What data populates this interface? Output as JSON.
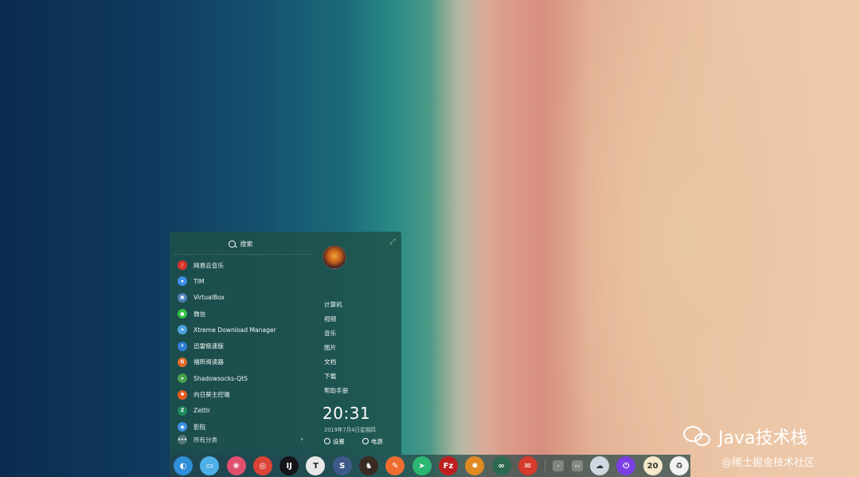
{
  "launcher": {
    "search_label": "搜索",
    "apps": [
      {
        "label": "网易云音乐",
        "icon": "netease-music-icon",
        "color": "#d8332a",
        "glyph": "♪"
      },
      {
        "label": "TIM",
        "icon": "tim-icon",
        "color": "#3a8ee6",
        "glyph": "★"
      },
      {
        "label": "VirtualBox",
        "icon": "virtualbox-icon",
        "color": "#4a7fb8",
        "glyph": "▣"
      },
      {
        "label": "微信",
        "icon": "wechat-icon",
        "color": "#35c24a",
        "glyph": "●"
      },
      {
        "label": "Xtreme Download Manager",
        "icon": "xdm-icon",
        "color": "#4aa3df",
        "glyph": "✦"
      },
      {
        "label": "迅雷极速版",
        "icon": "thunder-icon",
        "color": "#2f7dd6",
        "glyph": "✈"
      },
      {
        "label": "福昕阅读器",
        "icon": "foxit-reader-icon",
        "color": "#e06a2b",
        "glyph": "G"
      },
      {
        "label": "Shadowsocks-QtS",
        "icon": "shadowsocks-icon",
        "color": "#47a14a",
        "glyph": "➤"
      },
      {
        "label": "向日葵主控端",
        "icon": "sunlogin-icon",
        "color": "#e55a1f",
        "glyph": "✺"
      },
      {
        "label": "Zettlr",
        "icon": "zettlr-icon",
        "color": "#1f8a5a",
        "glyph": "Z"
      },
      {
        "label": "影院",
        "icon": "cinema-icon",
        "color": "#3d8fe0",
        "glyph": "◉"
      }
    ],
    "all_categories": "所有分类",
    "nav": [
      "计算机",
      "视频",
      "音乐",
      "图片",
      "文档",
      "下载",
      "帮助手册"
    ],
    "clock": "20:31",
    "date": "2019年7月4日星期四",
    "settings_label": "设置",
    "power_label": "电源"
  },
  "dock": {
    "apps": [
      {
        "icon": "deepin-launcher-icon",
        "color": "#2f8fd8",
        "glyph": "◐"
      },
      {
        "icon": "file-manager-icon",
        "color": "#4fb0e8",
        "glyph": "▭"
      },
      {
        "icon": "sakura-icon",
        "color": "#e0506e",
        "glyph": "❀"
      },
      {
        "icon": "chrome-icon",
        "color": "#db4437",
        "glyph": "◎"
      },
      {
        "icon": "intellij-idea-icon",
        "color": "#16151a",
        "glyph": "IJ"
      },
      {
        "icon": "typora-icon",
        "color": "#e8e8e8",
        "glyph": "T"
      },
      {
        "icon": "sublime-s-icon",
        "color": "#3d5a8a",
        "glyph": "S"
      },
      {
        "icon": "horse-icon",
        "color": "#3a2a22",
        "glyph": "♞"
      },
      {
        "icon": "postman-icon",
        "color": "#ef6c2f",
        "glyph": "✎"
      },
      {
        "icon": "send-arrow-icon",
        "color": "#2bb673",
        "glyph": "➤"
      },
      {
        "icon": "filezilla-icon",
        "color": "#bf1f1f",
        "glyph": "Fz"
      },
      {
        "icon": "settings-gear-icon",
        "color": "#e08a24",
        "glyph": "✹"
      },
      {
        "icon": "share-icon",
        "color": "#2c6a52",
        "glyph": "∞"
      },
      {
        "icon": "mail-icon",
        "color": "#d63a2a",
        "glyph": "✉"
      }
    ],
    "tray": [
      {
        "icon": "tray-arrow-icon",
        "glyph": "›"
      },
      {
        "icon": "tray-keyboard-icon",
        "glyph": "▭"
      },
      {
        "icon": "weather-cloud-icon",
        "color": "#cfd8e0",
        "glyph": "☁"
      },
      {
        "icon": "power-icon",
        "color": "#7b3fe4",
        "glyph": "⏻"
      },
      {
        "icon": "clock-20-icon",
        "color": "#f4e9c8",
        "glyph": "20"
      },
      {
        "icon": "trash-icon",
        "color": "#f2f2f2",
        "glyph": "♻"
      }
    ]
  },
  "watermark": {
    "title": "Java技术栈",
    "source": "@稀土掘金技术社区"
  }
}
